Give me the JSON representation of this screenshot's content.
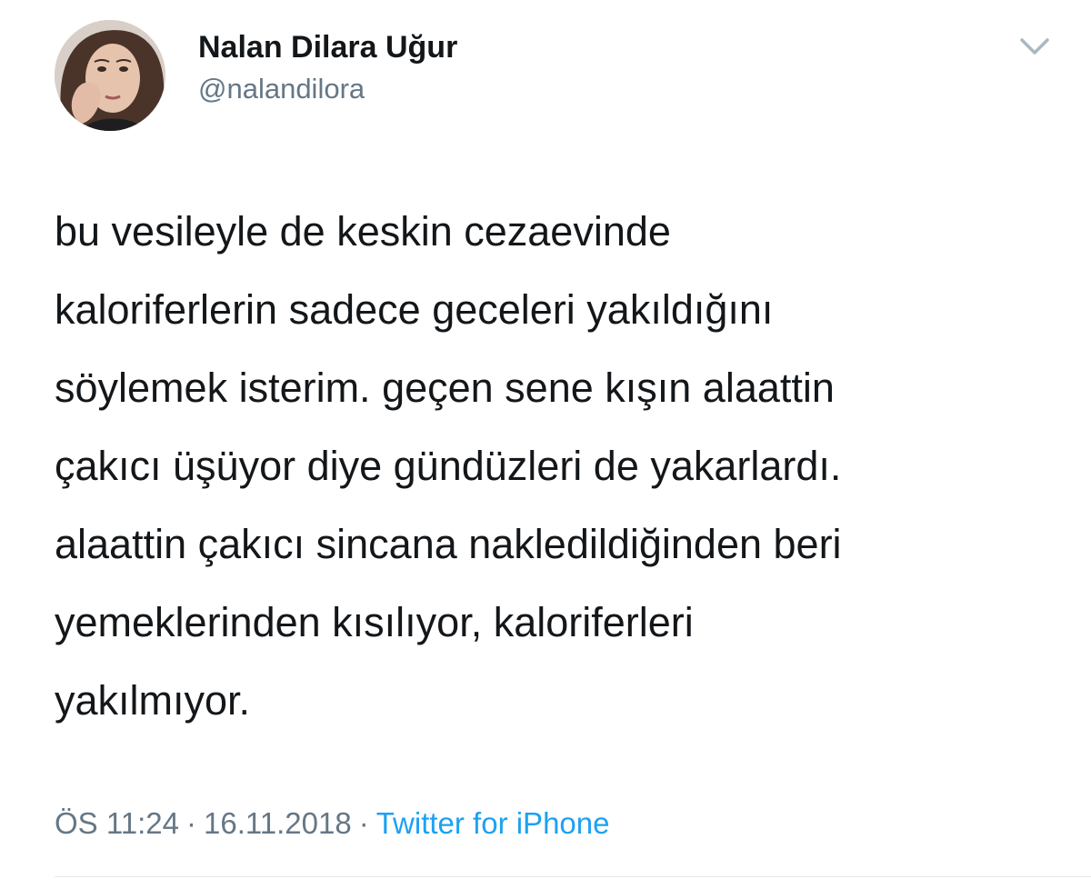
{
  "author": {
    "display_name": "Nalan Dilara Uğur",
    "handle": "@nalandilora",
    "avatar_icon": "profile-photo"
  },
  "tweet": {
    "text": "bu vesileyle de keskin cezaevinde\nkaloriferlerin sadece geceleri yakıldığını\nsöylemek isterim. geçen sene kışın alaattin\nçakıcı üşüyor diye gündüzleri de yakarlardı.\nalaattin çakıcı sincana nakledildiğinden beri\nyemeklerinden kısılıyor, kaloriferleri\nyakılmıyor."
  },
  "meta": {
    "time": "ÖS 11:24",
    "separator": "·",
    "date": "16.11.2018",
    "source": "Twitter for iPhone"
  },
  "colors": {
    "text": "#14171a",
    "secondary": "#657786",
    "link": "#1da1f2",
    "divider": "#e1e8ed"
  },
  "icons": {
    "menu": "chevron-down-icon"
  }
}
